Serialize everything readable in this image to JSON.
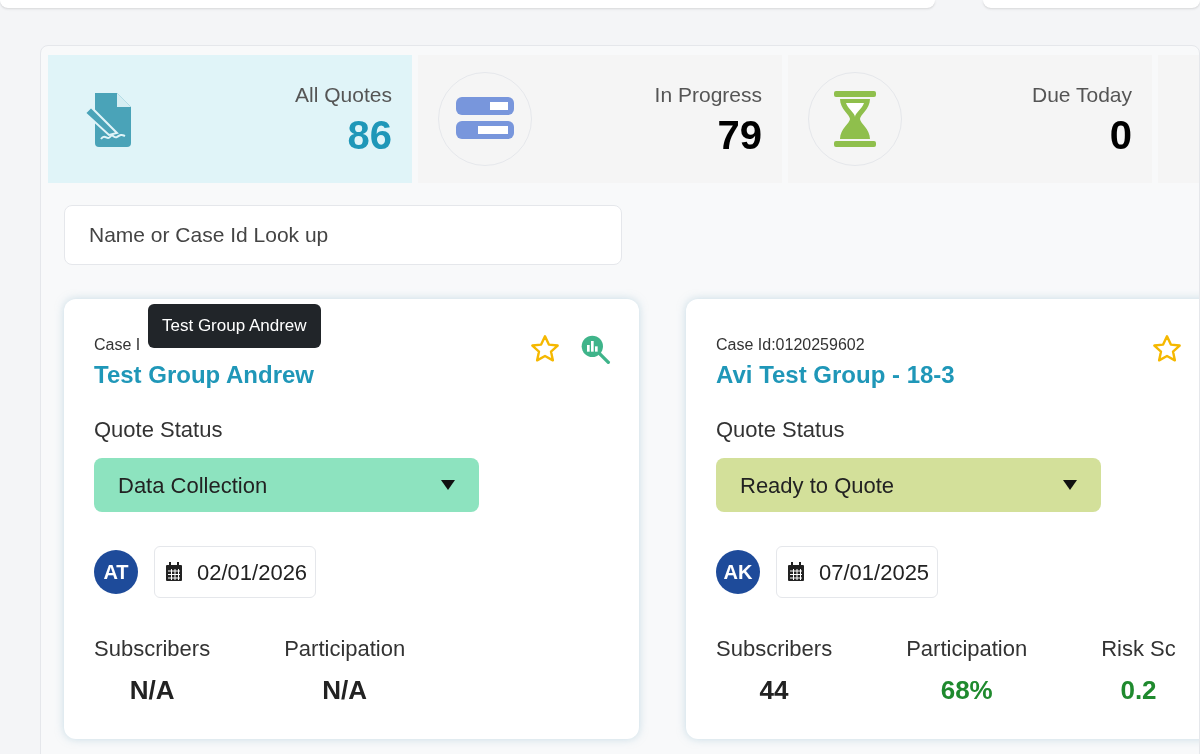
{
  "stats": [
    {
      "kind": "document",
      "label": "All Quotes",
      "value": "86",
      "selected": true
    },
    {
      "kind": "progress",
      "label": "In Progress",
      "value": "79",
      "selected": false
    },
    {
      "kind": "hourglass",
      "label": "Due Today",
      "value": "0",
      "selected": false
    }
  ],
  "search": {
    "placeholder": "Name or Case Id Look up"
  },
  "cards": [
    {
      "case_id": "Case I",
      "name": "Test Group Andrew",
      "tooltip": "Test Group Andrew",
      "favorite": false,
      "status_label": "Quote Status",
      "status": "Data Collection",
      "color": "#8de3bf",
      "avatar": "AT",
      "date": "02/01/2026",
      "metrics": [
        {
          "label": "Subscribers",
          "value": "N/A",
          "kind": "plain"
        },
        {
          "label": "Participation",
          "value": "N/A",
          "kind": "plain"
        }
      ]
    },
    {
      "case_id": "Case Id:0120259602",
      "name": "Avi Test Group - 18-3",
      "favorite": false,
      "status_label": "Quote Status",
      "status": "Ready to Quote",
      "color": "#d3e09a",
      "avatar": "AK",
      "date": "07/01/2025",
      "metrics": [
        {
          "label": "Subscribers",
          "value": "44",
          "kind": "plain"
        },
        {
          "label": "Participation",
          "value": "68%",
          "kind": "good"
        },
        {
          "label": "Risk Sc",
          "value": "0.2",
          "kind": "good"
        }
      ]
    }
  ]
}
